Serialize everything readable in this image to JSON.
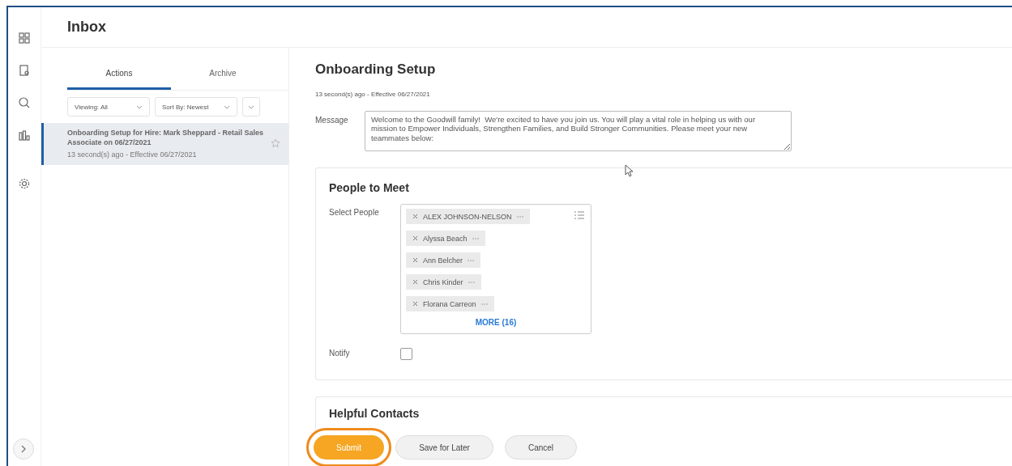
{
  "header": {
    "title": "Inbox"
  },
  "inbox": {
    "tabs": [
      {
        "label": "Actions",
        "selected": true
      },
      {
        "label": "Archive",
        "selected": false
      }
    ],
    "filters": [
      {
        "label": "Viewing: All"
      },
      {
        "label": "Sort By: Newest"
      }
    ],
    "items": [
      {
        "title": "Onboarding Setup for Hire: Mark Sheppard - Retail Sales Associate on 06/27/2021",
        "meta": "13 second(s) ago - Effective 06/27/2021",
        "selected": true,
        "starred": false
      }
    ]
  },
  "task": {
    "title": "Onboarding Setup",
    "meta": "13 second(s) ago - Effective 06/27/2021",
    "message_label": "Message",
    "message": "Welcome to the Goodwill family!  We're excited to have you join us. You will play a vital role in helping us with our mission to Empower Individuals, Strengthen Families, and Build Stronger Communities. Please meet your new teammates below:",
    "people_section": {
      "title": "People to Meet",
      "select_label": "Select People",
      "people": [
        "ALEX JOHNSON-NELSON",
        "Alyssa Beach",
        "Ann Belcher",
        "Chris Kinder",
        "Florana Carreon"
      ],
      "more": "MORE (16)",
      "notify_label": "Notify",
      "notify": false
    },
    "contacts_section": {
      "title": "Helpful Contacts"
    }
  },
  "buttons": [
    {
      "label": "Submit",
      "kind": "primary",
      "highlighted": true
    },
    {
      "label": "Save for Later",
      "kind": "secondary",
      "highlighted": false
    },
    {
      "label": "Cancel",
      "kind": "secondary",
      "highlighted": false
    }
  ]
}
